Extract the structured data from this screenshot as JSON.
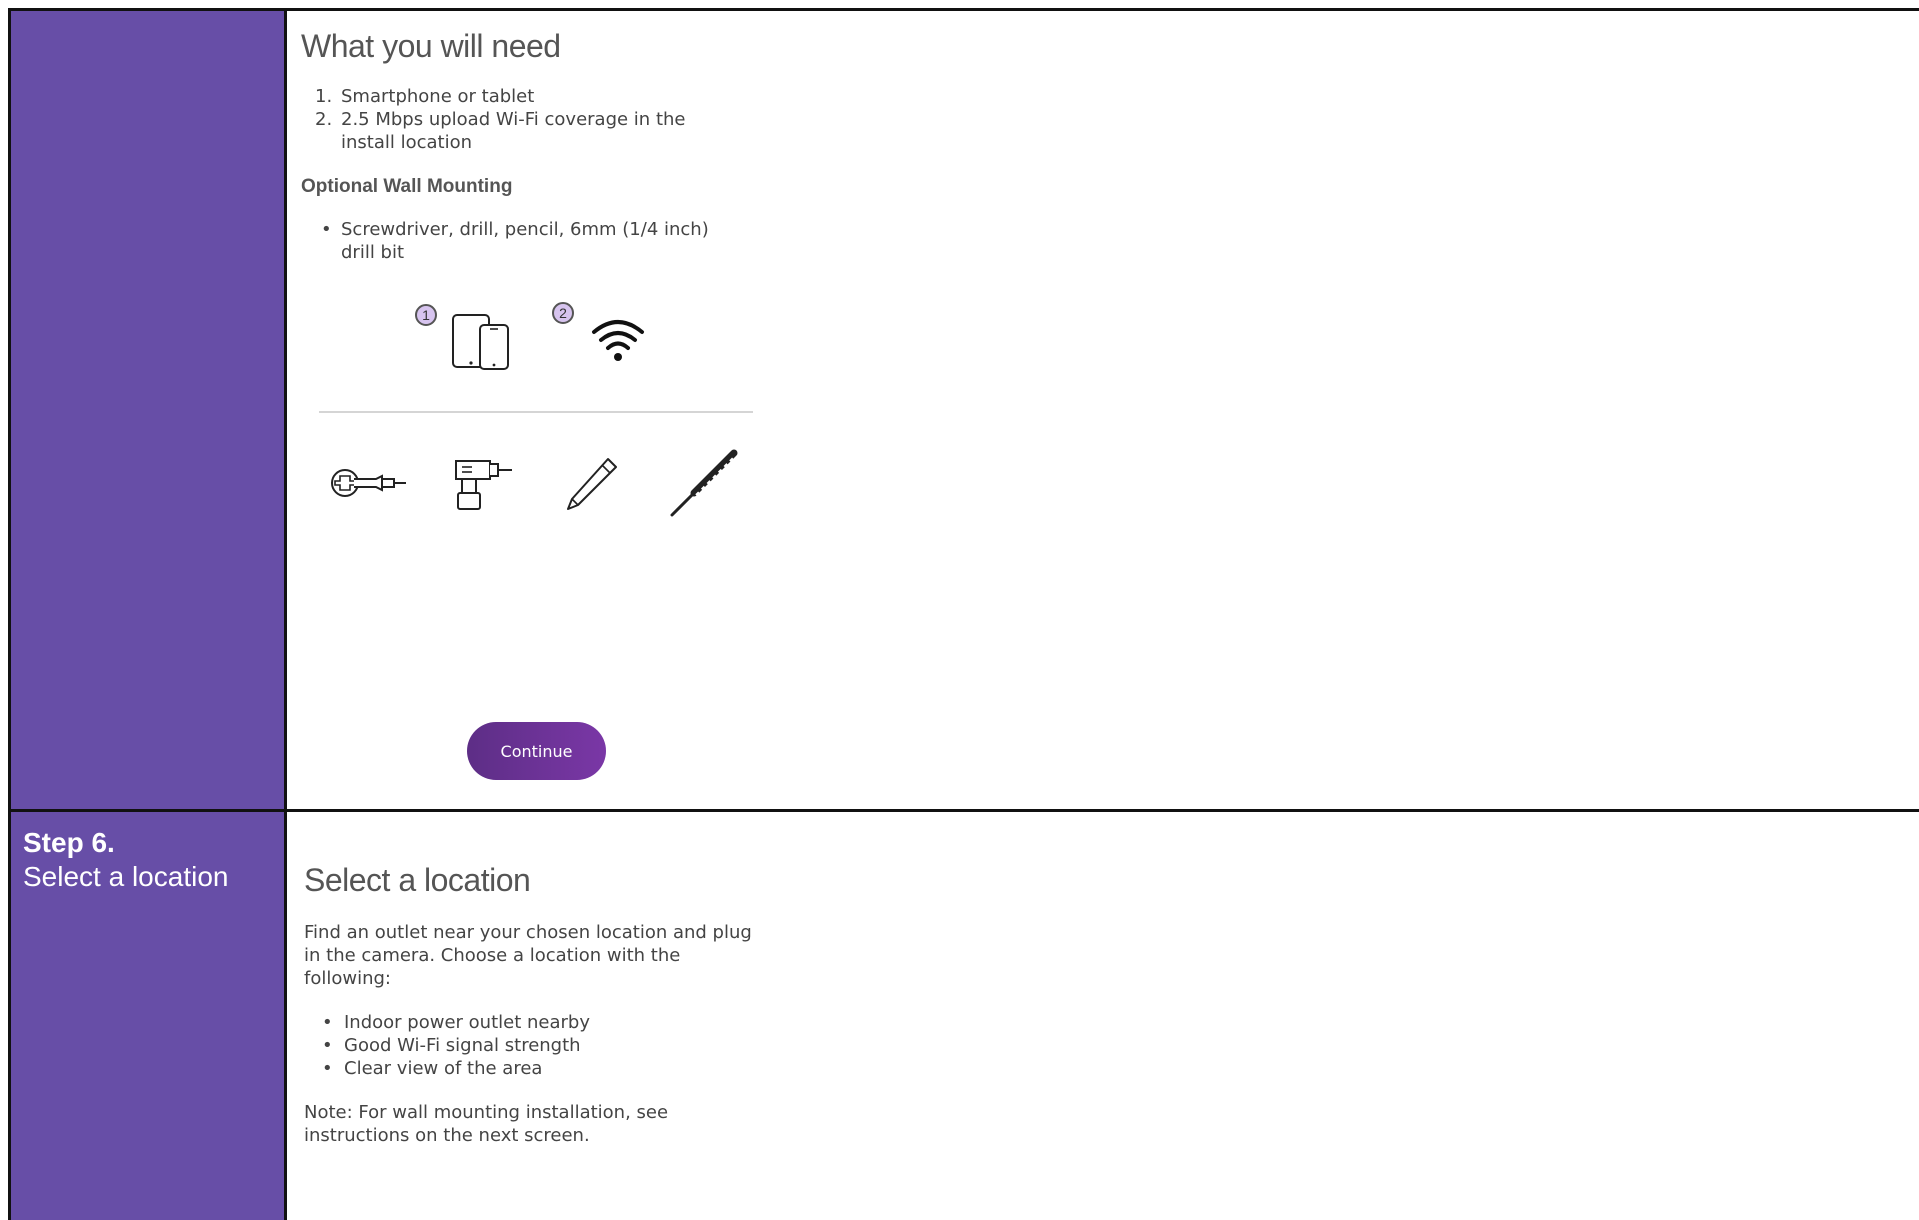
{
  "step": {
    "number": "Step 6.",
    "name": "Select a location"
  },
  "top_panel": {
    "title": "What you will need",
    "needs": [
      {
        "marker": "1.",
        "text": "Smartphone or tablet"
      },
      {
        "marker": "2.",
        "text": "2.5 Mbps upload Wi-Fi coverage in the install location"
      }
    ],
    "optional_heading": "Optional Wall Mounting",
    "optional_items": [
      {
        "marker": "•",
        "text": "Screwdriver, drill, pencil, 6mm (1/4 inch) drill bit"
      }
    ],
    "badges": [
      "1",
      "2"
    ],
    "icons": [
      "devices-icon",
      "wifi-icon",
      "screwdriver-icon",
      "drill-icon",
      "pencil-icon",
      "drill-bit-icon"
    ],
    "continue_label": "Continue",
    "accent_color": "#674ea7"
  },
  "bottom_panel": {
    "title": "Select a location",
    "intro": "Find an outlet near your chosen location and plug in the camera. Choose a location with the following:",
    "criteria": [
      {
        "marker": "•",
        "text": "Indoor power outlet nearby"
      },
      {
        "marker": "•",
        "text": "Good Wi-Fi signal strength"
      },
      {
        "marker": "•",
        "text": "Clear view of the area"
      }
    ],
    "note": "Note: For wall mounting installation, see instructions on the next screen."
  }
}
